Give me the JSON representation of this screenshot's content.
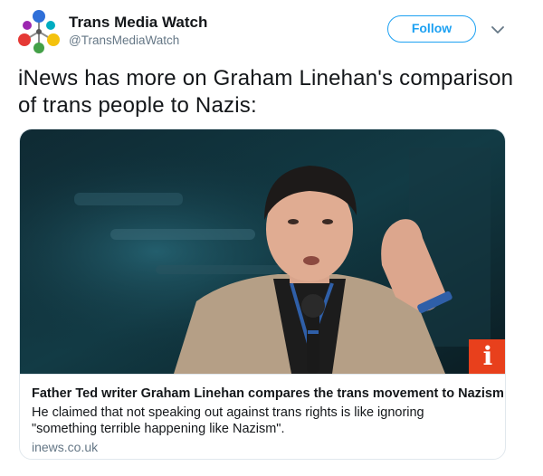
{
  "author": {
    "display_name": "Trans Media Watch",
    "handle": "@TransMediaWatch",
    "avatar_icon": "multicolor-pin-logo"
  },
  "actions": {
    "follow_label": "Follow",
    "menu_icon": "chevron-down-icon"
  },
  "tweet": {
    "text": "iNews has more on Graham Linehan's comparison of trans people to Nazis:"
  },
  "card": {
    "image_alt": "photo-of-man-speaking-into-microphone",
    "badge_letter": "i",
    "title": "Father Ted writer Graham Linehan compares the trans movement to Nazism",
    "description": "He claimed that not speaking out against trans rights is like ignoring \"something terrible happening like Nazism\".",
    "domain": "inews.co.uk"
  },
  "colors": {
    "accent": "#1da1f2",
    "text_primary": "#14171a",
    "text_secondary": "#657786",
    "border": "#e1e8ed",
    "brand_badge": "#e8401c"
  }
}
